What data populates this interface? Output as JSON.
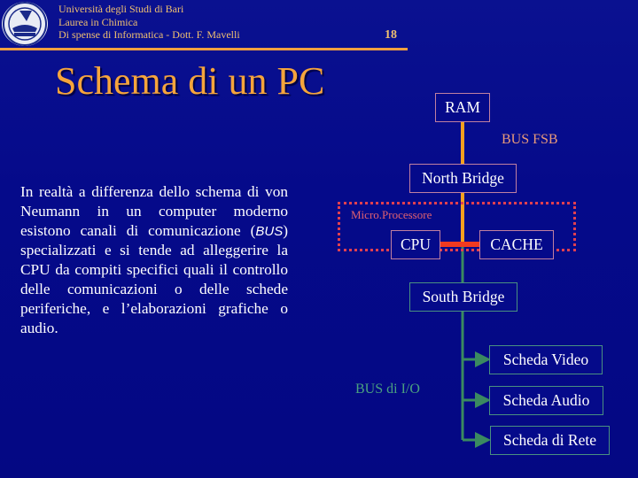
{
  "header": {
    "lines": [
      "Università degli Studi di Bari",
      "Laurea in Chimica",
      "Di spense di Informatica - Dott. F. Mavelli"
    ],
    "slide_number": "18",
    "logo": "university-seal-icon"
  },
  "title": "Schema di un PC",
  "body": {
    "before_bus": "In realtà a differenza dello schema di von Neumann in un computer moderno esistono canali di comunicazione (",
    "bus_word": "BUS",
    "after_bus": ") specializzati e si tende ad alleggerire la CPU da compiti specifici quali il controllo delle comunicazioni o delle schede periferiche, e l’elaborazioni grafiche o audio."
  },
  "diagram": {
    "nodes": {
      "ram": "RAM",
      "north_bridge": "North Bridge",
      "cpu": "CPU",
      "cache": "CACHE",
      "south_bridge": "South Bridge",
      "video": "Scheda Video",
      "audio": "Scheda Audio",
      "network": "Scheda di Rete"
    },
    "labels": {
      "fsb": "BUS FSB",
      "micro": "Micro.Processore",
      "io": "BUS di I/O"
    },
    "colors": {
      "fsb_bus": "#f5a020",
      "cpu_link": "#f03a20",
      "io_bus": "#3a8a60",
      "micro_frame": "#e04050"
    }
  }
}
